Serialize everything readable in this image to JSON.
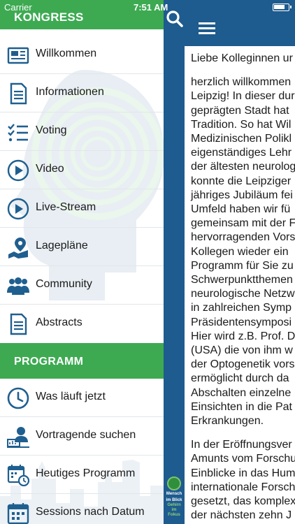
{
  "status_bar": {
    "carrier": "Carrier",
    "time": "7:51 AM",
    "battery_level": 0.8
  },
  "drawer": {
    "title": "KONGRESS",
    "items": [
      {
        "label": "Willkommen",
        "icon": "newspaper-icon"
      },
      {
        "label": "Informationen",
        "icon": "document-icon"
      },
      {
        "label": "Voting",
        "icon": "checklist-icon"
      },
      {
        "label": "Video",
        "icon": "play-circle-icon"
      },
      {
        "label": "Live-Stream",
        "icon": "play-circle-icon"
      },
      {
        "label": "Lagepläne",
        "icon": "map-pin-icon"
      },
      {
        "label": "Community",
        "icon": "people-icon"
      },
      {
        "label": "Abstracts",
        "icon": "document-icon"
      }
    ],
    "section_title": "PROGRAMM",
    "program_items": [
      {
        "label": "Was läuft jetzt",
        "icon": "clock-icon"
      },
      {
        "label": "Vortragende suchen",
        "icon": "speaker-icon"
      },
      {
        "label": "Heutiges Programm",
        "icon": "calendar-clock-icon"
      },
      {
        "label": "Sessions nach Datum",
        "icon": "calendar-icon"
      }
    ]
  },
  "content": {
    "salutation": "Liebe Kolleginnen ur",
    "paragraph1": [
      "herzlich willkommen",
      "Leipzig! In dieser dur",
      "geprägten Stadt hat",
      "Tradition. So hat Wil",
      "Medizinischen Polikl",
      "eigenständiges Lehr",
      "der ältesten neurolog",
      "konnte die Leipziger",
      "jähriges Jubiläum fei",
      "Umfeld haben wir fü",
      "gemeinsam mit der F",
      "hervorragenden Vors",
      "Kollegen wieder ein",
      "Programm für Sie zu",
      "Schwerpunktthemen",
      "neurologische Netzw",
      "in zahlreichen Symp",
      "Präsidentensymposi",
      "Hier wird z.B. Prof. D",
      "(USA) die von ihm w",
      "der Optogenetik vors",
      "ermöglicht durch da",
      "Abschalten einzelne",
      "Einsichten in die Pat",
      "Erkrankungen."
    ],
    "paragraph2": [
      "In der Eröffnungsver",
      "Amunts vom Forschu",
      "Einblicke in das Hum",
      "internationale Forsch",
      "gesetzt, das komplex",
      "der nächsten zehn J"
    ]
  },
  "brand": {
    "line1": "Mensch",
    "line2": "im Blick",
    "line3": "Gehirn",
    "line4": "im Fokus"
  },
  "colors": {
    "green": "#3daa52",
    "blue": "#1e5b8e",
    "icon_blue": "#1f5f8f"
  }
}
